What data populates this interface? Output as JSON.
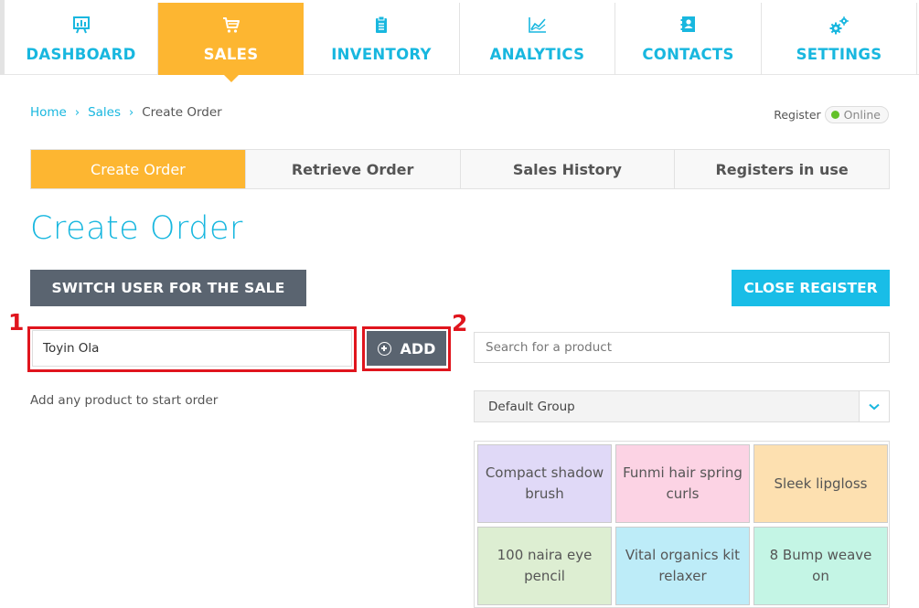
{
  "nav": {
    "items": [
      {
        "label": "DASHBOARD",
        "icon": "dashboard-chart-icon"
      },
      {
        "label": "SALES",
        "icon": "cart-icon"
      },
      {
        "label": "INVENTORY",
        "icon": "clipboard-icon"
      },
      {
        "label": "ANALYTICS",
        "icon": "line-chart-icon"
      },
      {
        "label": "CONTACTS",
        "icon": "contacts-book-icon"
      },
      {
        "label": "SETTINGS",
        "icon": "gears-icon"
      }
    ],
    "active": "SALES",
    "accent_color": "#18b7df",
    "active_color": "#fdb631"
  },
  "breadcrumb": {
    "items": [
      "Home",
      "Sales",
      "Create Order"
    ]
  },
  "register": {
    "label": "Register",
    "status": "Online",
    "status_color": "#64c12a"
  },
  "tabs": [
    {
      "label": "Create Order",
      "active": true
    },
    {
      "label": "Retrieve Order",
      "active": false
    },
    {
      "label": "Sales History",
      "active": false
    },
    {
      "label": "Registers in use",
      "active": false
    }
  ],
  "page": {
    "title": "Create Order",
    "switch_user_label": "SWITCH USER FOR THE SALE",
    "close_register_label": "CLOSE REGISTER",
    "customer_value": "Toyin Ola",
    "add_label": "ADD",
    "hint": "Add any product to start order",
    "search_placeholder": "Search for a product",
    "group_selected": "Default Group"
  },
  "annotations": [
    {
      "number": "1",
      "target": "customer-input"
    },
    {
      "number": "2",
      "target": "add-button"
    }
  ],
  "annotation_color": "#e0151d",
  "products": [
    {
      "name": "Compact shadow brush",
      "color": "#e0d9f7"
    },
    {
      "name": "Funmi hair spring curls",
      "color": "#fcd3e4"
    },
    {
      "name": "Sleek lipgloss",
      "color": "#fde0b0"
    },
    {
      "name": "100 naira eye pencil",
      "color": "#ddeed2"
    },
    {
      "name": "Vital organics kit relaxer",
      "color": "#bdecf8"
    },
    {
      "name": "8 Bump weave on",
      "color": "#c4f5e5"
    }
  ]
}
